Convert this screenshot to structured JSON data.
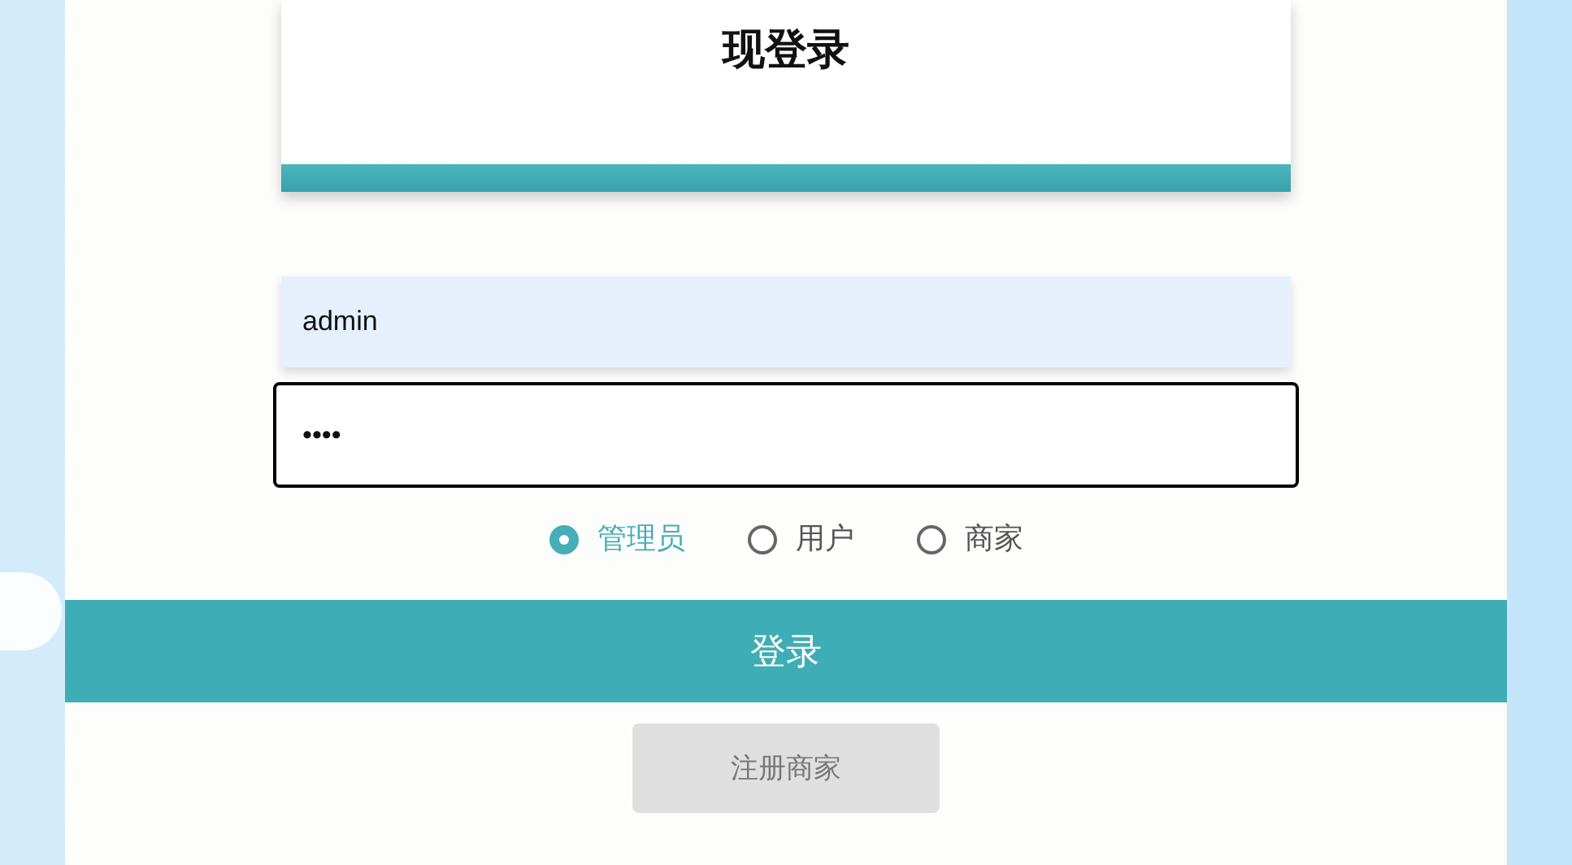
{
  "header": {
    "title": "现登录"
  },
  "form": {
    "username": {
      "value": "admin"
    },
    "password": {
      "value": "••••",
      "focused": true
    },
    "roles": [
      {
        "label": "管理员",
        "selected": true
      },
      {
        "label": "用户",
        "selected": false
      },
      {
        "label": "商家",
        "selected": false
      }
    ],
    "login_button": "登录",
    "register_button": "注册商家"
  }
}
